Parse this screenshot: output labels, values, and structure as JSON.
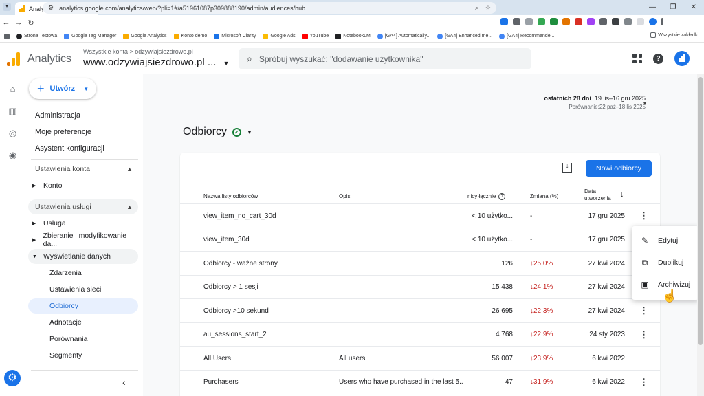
{
  "browser": {
    "tab_title": "Analytics",
    "url": "analytics.google.com/analytics/web/?pli=1#/a51961087p309888190/admin/audiences/hub",
    "bookmarks": [
      "Strona Testowa",
      "Google Tag Manager",
      "Google Analytics",
      "Konto demo",
      "Microsoft Clarity",
      "Google Ads",
      "YouTube",
      "NotebookLM",
      "[GA4] Automatically...",
      "[GA4] Enhanced me...",
      "[GA4] Recommende..."
    ],
    "bookmarks_all": "Wszystkie zakładki"
  },
  "header": {
    "app_name": "Analytics",
    "breadcrumb": "Wszystkie konta > odzywiajsiezdrowo.pl",
    "property": "www.odzywiajsiezdrowo.pl ...",
    "search_placeholder": "Spróbuj wyszukać: \"dodawanie użytkownika\""
  },
  "nav": {
    "create": "Utwórz",
    "admin": "Administracja",
    "prefs": "Moje preferencje",
    "assistant": "Asystent konfiguracji",
    "account_section": "Ustawienia konta",
    "account": "Konto",
    "service_section": "Ustawienia usługi",
    "service": "Usługa",
    "collection": "Zbieranie i modyfikowanie da...",
    "display": "Wyświetlanie danych",
    "events": "Zdarzenia",
    "network": "Ustawienia sieci",
    "audiences": "Odbiorcy",
    "annotations": "Adnotacje",
    "comparisons": "Porównania",
    "segments": "Segmenty"
  },
  "main": {
    "date_label": "ostatnich 28 dni",
    "date_range": "19 lis–16 gru 2025",
    "compare": "Porównanie:22 paź–18 lis 2025",
    "title": "Odbiorcy",
    "new_button": "Nowi odbiorcy",
    "columns": {
      "name": "Nazwa listy odbiorców",
      "desc": "Opis",
      "users": "nicy łącznie",
      "change": "Zmiana (%)",
      "created_1": "Data",
      "created_2": "utworzenia"
    },
    "rows": [
      {
        "name": "view_item_no_cart_30d",
        "desc": "",
        "users": "< 10 użytko...",
        "change": "-",
        "date": "17 gru 2025"
      },
      {
        "name": "view_item_30d",
        "desc": "",
        "users": "< 10 użytko...",
        "change": "-",
        "date": "17 gru 2025"
      },
      {
        "name": "Odbiorcy - ważne strony",
        "desc": "",
        "users": "126",
        "change": "↓25,0%",
        "date": "27 kwi 2024"
      },
      {
        "name": "Odbiorcy > 1 sesji",
        "desc": "",
        "users": "15 438",
        "change": "↓24,1%",
        "date": "27 kwi 2024"
      },
      {
        "name": "Odbiorcy >10 sekund",
        "desc": "",
        "users": "26 695",
        "change": "↓22,3%",
        "date": "27 kwi 2024"
      },
      {
        "name": "au_sessions_start_2",
        "desc": "",
        "users": "4 768",
        "change": "↓22,9%",
        "date": "24 sty 2023"
      },
      {
        "name": "All Users",
        "desc": "All users",
        "users": "56 007",
        "change": "↓23,9%",
        "date": "6 kwi 2022"
      },
      {
        "name": "Purchasers",
        "desc": "Users who have purchased in the last 5...",
        "users": "47",
        "change": "↓31,9%",
        "date": "6 kwi 2022"
      }
    ]
  },
  "menu": {
    "edit": "Edytuj",
    "duplicate": "Duplikuj",
    "archive": "Archiwizuj"
  },
  "colors": {
    "accent": "#1a73e8",
    "negative": "#c5221f",
    "active_bg": "#e8f0fe"
  }
}
